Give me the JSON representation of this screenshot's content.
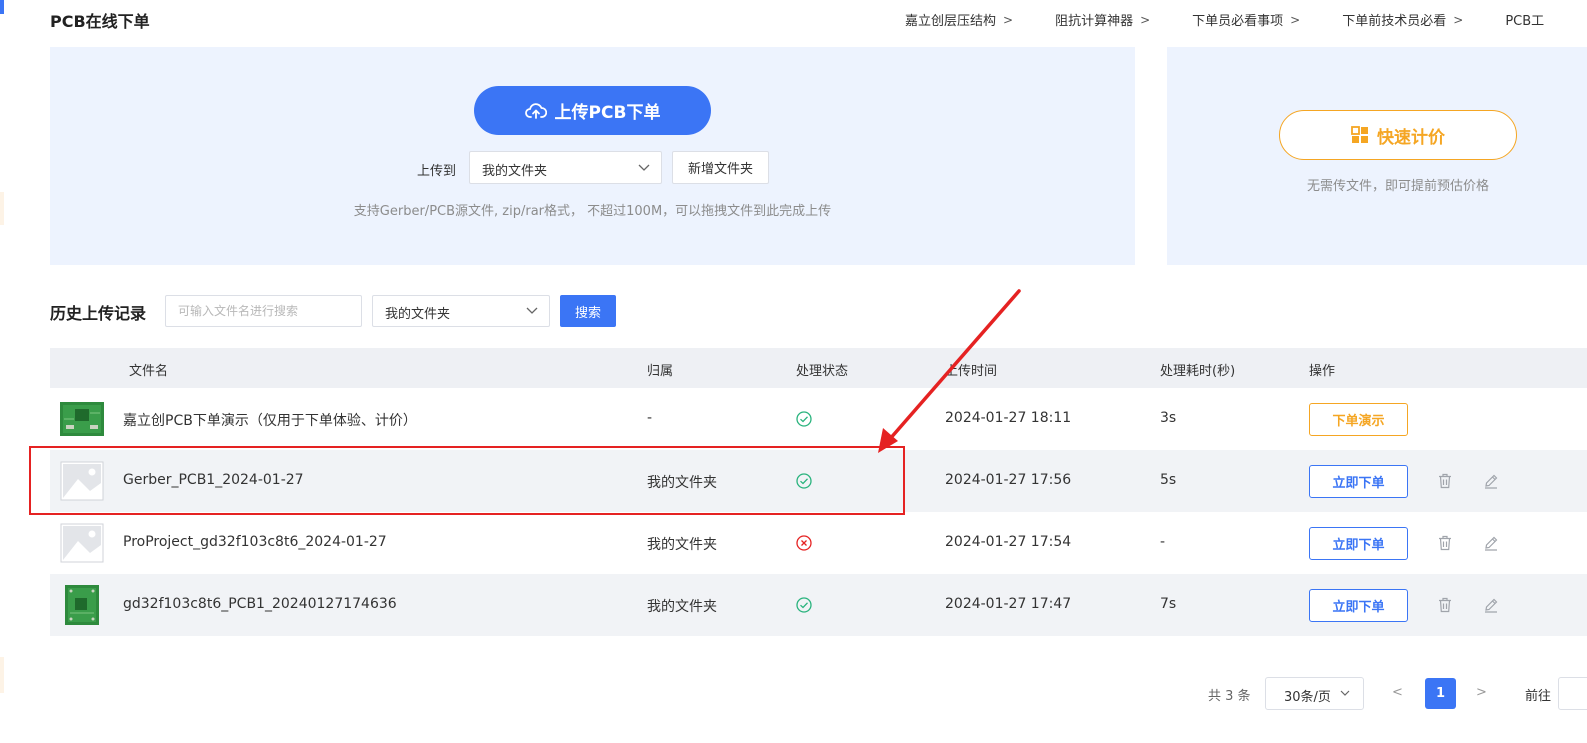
{
  "header": {
    "title": "PCB在线下单",
    "links": [
      "嘉立创层压结构",
      "阻抗计算神器",
      "下单员必看事项",
      "下单前技术员必看",
      "PCB工"
    ]
  },
  "upload": {
    "button_label": "上传PCB下单",
    "upload_to_label": "上传到",
    "folder_value": "我的文件夹",
    "new_folder_label": "新增文件夹",
    "hint": "支持Gerber/PCB源文件, zip/rar格式， 不超过100M，可以拖拽文件到此完成上传"
  },
  "quote": {
    "button_label": "快速计价",
    "hint": "无需传文件，即可提前预估价格"
  },
  "history": {
    "title": "历史上传记录",
    "search_placeholder": "可输入文件名进行搜索",
    "filter_value": "我的文件夹",
    "search_label": "搜索"
  },
  "table": {
    "columns": {
      "name": "文件名",
      "owner": "归属",
      "status": "处理状态",
      "time": "上传时间",
      "duration": "处理耗时(秒)",
      "actions": "操作"
    },
    "rows": [
      {
        "name": "嘉立创PCB下单演示（仅用于下单体验、计价）",
        "owner": "-",
        "status": "success",
        "time": "2024-01-27 18:11",
        "duration": "3s",
        "action": "下单演示",
        "thumb": "pcb-green"
      },
      {
        "name": "Gerber_PCB1_2024-01-27",
        "owner": "我的文件夹",
        "status": "success",
        "time": "2024-01-27 17:56",
        "duration": "5s",
        "action": "立即下单",
        "thumb": "placeholder"
      },
      {
        "name": "ProProject_gd32f103c8t6_2024-01-27",
        "owner": "我的文件夹",
        "status": "failed",
        "time": "2024-01-27 17:54",
        "duration": "-",
        "action": "立即下单",
        "thumb": "placeholder"
      },
      {
        "name": "gd32f103c8t6_PCB1_20240127174636",
        "owner": "我的文件夹",
        "status": "success",
        "time": "2024-01-27 17:47",
        "duration": "7s",
        "action": "立即下单",
        "thumb": "pcb-green"
      }
    ]
  },
  "pagination": {
    "total": "共 3 条",
    "page_size": "30条/页",
    "current_page": "1",
    "goto_label": "前往"
  },
  "colors": {
    "primary": "#3b75f5",
    "orange": "#f5a623",
    "success": "#29b37d",
    "error": "#e52222",
    "panel_bg": "#edf3fe"
  }
}
